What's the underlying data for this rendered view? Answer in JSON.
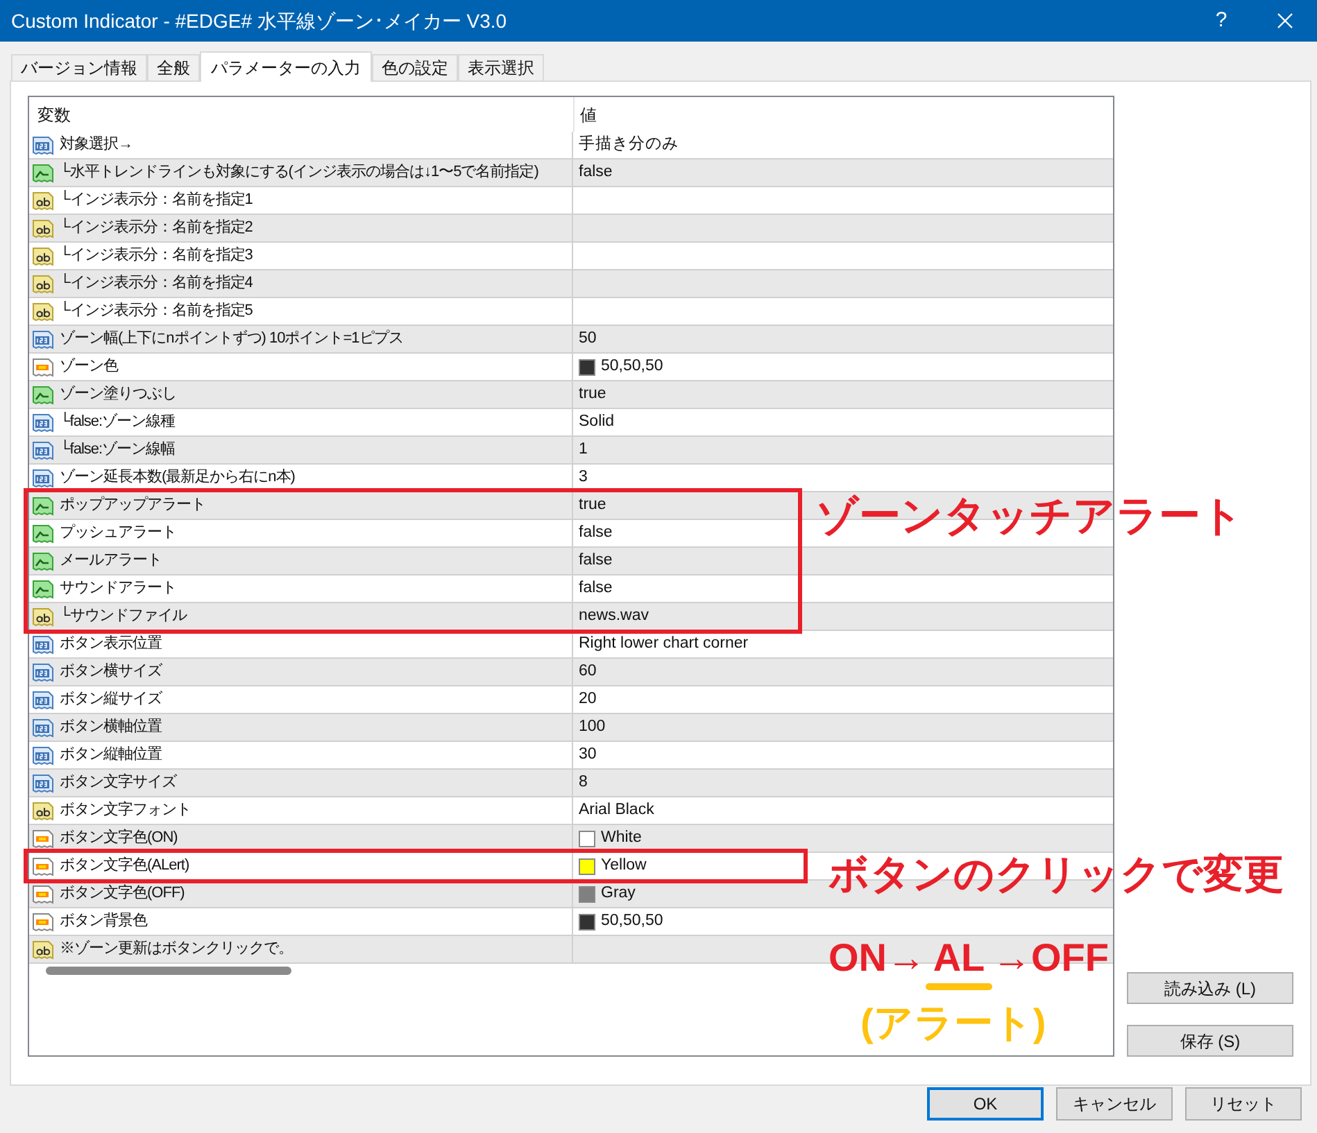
{
  "window": {
    "title": "Custom Indicator - #EDGE# 水平線ゾーン･メイカー V3.0",
    "help": "?"
  },
  "tabs": [
    {
      "label": "バージョン情報",
      "selected": false
    },
    {
      "label": "全般",
      "selected": false
    },
    {
      "label": "パラメーターの入力",
      "selected": true
    },
    {
      "label": "色の設定",
      "selected": false
    },
    {
      "label": "表示選択",
      "selected": false
    }
  ],
  "table": {
    "columns": [
      "変数",
      "値"
    ],
    "rows": [
      {
        "kind": "number",
        "name": "対象選択→",
        "value": "手描き分のみ"
      },
      {
        "kind": "bool",
        "name": "└水平トレンドラインも対象にする(インジ表示の場合は↓1〜5で名前指定)",
        "value": "false"
      },
      {
        "kind": "string",
        "name": "└インジ表示分：名前を指定1",
        "value": ""
      },
      {
        "kind": "string",
        "name": "└インジ表示分：名前を指定2",
        "value": ""
      },
      {
        "kind": "string",
        "name": "└インジ表示分：名前を指定3",
        "value": ""
      },
      {
        "kind": "string",
        "name": "└インジ表示分：名前を指定4",
        "value": ""
      },
      {
        "kind": "string",
        "name": "└インジ表示分：名前を指定5",
        "value": ""
      },
      {
        "kind": "number",
        "name": "ゾーン幅(上下にnポイントずつ) 10ポイント=1ピプス",
        "value": "50"
      },
      {
        "kind": "color",
        "name": "ゾーン色",
        "value": "50,50,50",
        "color": "#323232"
      },
      {
        "kind": "bool",
        "name": "ゾーン塗りつぶし",
        "value": "true"
      },
      {
        "kind": "number",
        "name": "└false:ゾーン線種",
        "value": "Solid"
      },
      {
        "kind": "number",
        "name": "└false:ゾーン線幅",
        "value": "1"
      },
      {
        "kind": "number",
        "name": "ゾーン延長本数(最新足から右にn本)",
        "value": "3"
      },
      {
        "kind": "bool",
        "name": "ポップアップアラート",
        "value": "true"
      },
      {
        "kind": "bool",
        "name": "プッシュアラート",
        "value": "false"
      },
      {
        "kind": "bool",
        "name": "メールアラート",
        "value": "false"
      },
      {
        "kind": "bool",
        "name": "サウンドアラート",
        "value": "false"
      },
      {
        "kind": "string",
        "name": "└サウンドファイル",
        "value": "news.wav"
      },
      {
        "kind": "number",
        "name": "ボタン表示位置",
        "value": "Right lower chart corner"
      },
      {
        "kind": "number",
        "name": "ボタン横サイズ",
        "value": "60"
      },
      {
        "kind": "number",
        "name": "ボタン縦サイズ",
        "value": "20"
      },
      {
        "kind": "number",
        "name": "ボタン横軸位置",
        "value": "100"
      },
      {
        "kind": "number",
        "name": "ボタン縦軸位置",
        "value": "30"
      },
      {
        "kind": "number",
        "name": "ボタン文字サイズ",
        "value": "8"
      },
      {
        "kind": "string",
        "name": "ボタン文字フォント",
        "value": "Arial Black"
      },
      {
        "kind": "color",
        "name": "ボタン文字色(ON)",
        "value": "White",
        "color": "#ffffff"
      },
      {
        "kind": "color",
        "name": "ボタン文字色(ALert)",
        "value": "Yellow",
        "color": "#ffff00"
      },
      {
        "kind": "color",
        "name": "ボタン文字色(OFF)",
        "value": "Gray",
        "color": "#808080"
      },
      {
        "kind": "color",
        "name": "ボタン背景色",
        "value": "50,50,50",
        "color": "#323232"
      },
      {
        "kind": "string",
        "name": "※ゾーン更新はボタンクリックで。",
        "value": ""
      }
    ]
  },
  "side_buttons": [
    "読み込み (L)",
    "保存 (S)"
  ],
  "footer_buttons": [
    "OK",
    "キャンセル",
    "リセット"
  ],
  "annotations": {
    "zone_alert": "ゾーンタッチアラート",
    "click_note": "ボタンのクリックで変更",
    "sequence": {
      "before": "ON→",
      "highlight": "AL",
      "after": "→OFF"
    },
    "sequence_note": "(アラート)"
  }
}
